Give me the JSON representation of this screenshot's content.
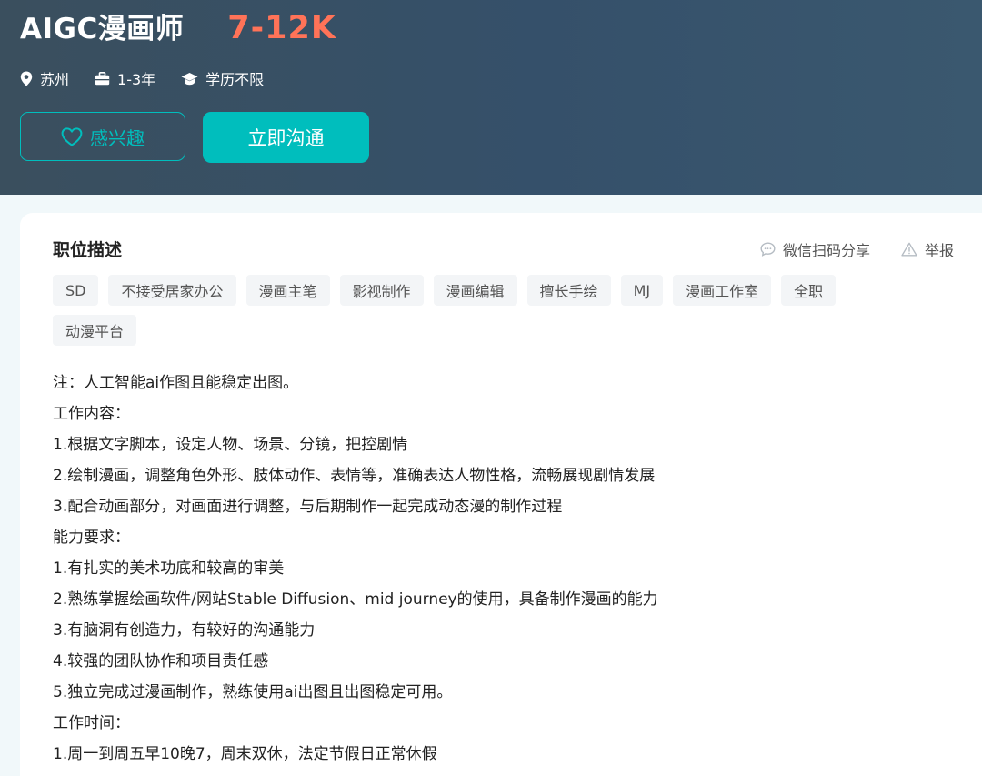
{
  "header": {
    "job_title": "AIGC漫画师",
    "salary": "7-12K",
    "meta": {
      "location": "苏州",
      "experience": "1-3年",
      "education": "学历不限"
    },
    "buttons": {
      "interest": "感兴趣",
      "chat": "立即沟通"
    }
  },
  "card": {
    "title": "职位描述",
    "share": "微信扫码分享",
    "report": "举报",
    "tags": [
      "SD",
      "不接受居家办公",
      "漫画主笔",
      "影视制作",
      "漫画编辑",
      "擅长手绘",
      "MJ",
      "漫画工作室",
      "全职",
      "动漫平台"
    ],
    "description": [
      "注：人工智能ai作图且能稳定出图。",
      "工作内容：",
      "1.根据文字脚本，设定人物、场景、分镜，把控剧情",
      "2.绘制漫画，调整角色外形、肢体动作、表情等，准确表达人物性格，流畅展现剧情发展",
      "3.配合动画部分，对画面进行调整，与后期制作一起完成动态漫的制作过程",
      "能力要求：",
      "1.有扎实的美术功底和较高的审美",
      "2.熟练掌握绘画软件/网站Stable Diffusion、mid journey的使用，具备制作漫画的能力",
      "3.有脑洞有创造力，有较好的沟通能力",
      "4.较强的团队协作和项目责任感",
      "5.独立完成过漫画制作，熟练使用ai出图且出图稳定可用。",
      "工作时间：",
      "1.周一到周五早10晚7，周末双休，法定节假日正常休假"
    ]
  },
  "colors": {
    "accent": "#00bebd",
    "salary": "#ff7358",
    "header_bg": "#3a4f5e"
  },
  "icons": {
    "location": "location-pin-icon",
    "experience": "briefcase-icon",
    "education": "graduation-cap-icon",
    "interest": "heart-icon",
    "share": "chat-bubble-icon",
    "report": "warning-icon"
  }
}
